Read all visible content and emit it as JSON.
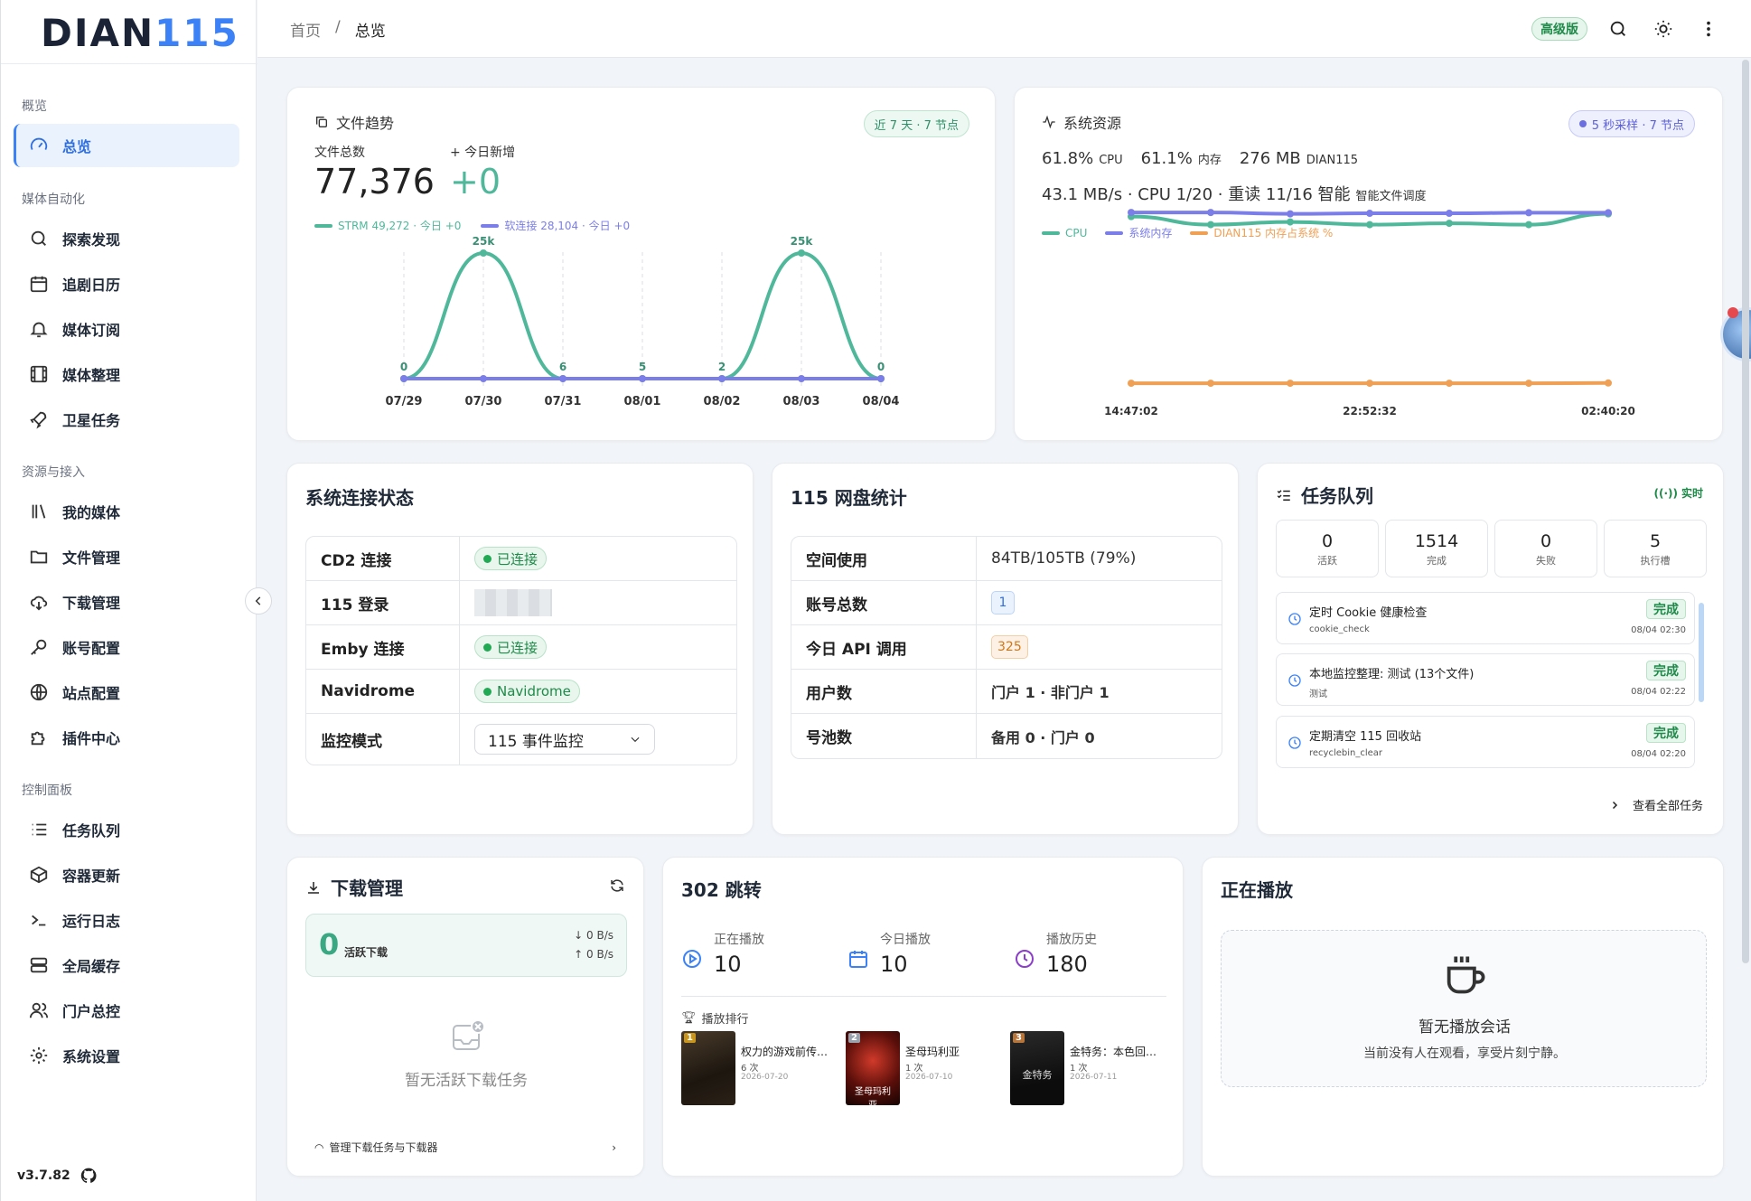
{
  "brand": {
    "logo_dark": "DIAN",
    "logo_blue": "115",
    "version": "v3.7.82"
  },
  "sidebar": {
    "sections": [
      "概览",
      "媒体自动化",
      "资源与接入",
      "控制面板"
    ],
    "items": [
      {
        "label": "总览",
        "icon": "gauge-icon"
      },
      {
        "label": "探索发现",
        "icon": "search-icon"
      },
      {
        "label": "追剧日历",
        "icon": "calendar-icon"
      },
      {
        "label": "媒体订阅",
        "icon": "bell-icon"
      },
      {
        "label": "媒体整理",
        "icon": "film-icon"
      },
      {
        "label": "卫星任务",
        "icon": "rocket-icon"
      },
      {
        "label": "我的媒体",
        "icon": "library-icon"
      },
      {
        "label": "文件管理",
        "icon": "folder-icon"
      },
      {
        "label": "下载管理",
        "icon": "cloud-download-icon"
      },
      {
        "label": "账号配置",
        "icon": "key-icon"
      },
      {
        "label": "站点配置",
        "icon": "globe-icon"
      },
      {
        "label": "插件中心",
        "icon": "puzzle-icon"
      },
      {
        "label": "任务队列",
        "icon": "list-icon"
      },
      {
        "label": "容器更新",
        "icon": "box-icon"
      },
      {
        "label": "运行日志",
        "icon": "terminal-icon"
      },
      {
        "label": "全局缓存",
        "icon": "server-icon"
      },
      {
        "label": "门户总控",
        "icon": "users-icon"
      },
      {
        "label": "系统设置",
        "icon": "gear-icon"
      }
    ]
  },
  "topbar": {
    "crumb_home": "首页",
    "crumb_sep": "/",
    "crumb_current": "总览",
    "edition": "高级版"
  },
  "file_trend": {
    "title": "文件趋势",
    "range_badge": "近 7 天 · 7 节点",
    "total_label": "文件总数",
    "total_value": "77,376",
    "today_label": "+ 今日新增",
    "today_value": "+0",
    "legend_strm": "STRM 49,272 · 今日 +0",
    "legend_soft": "软连接 28,104 · 今日 +0"
  },
  "sys_res": {
    "title": "系统资源",
    "badge": "5 秒采样 · 7 节点",
    "cpu_val": "61.8%",
    "cpu_lbl": "CPU",
    "mem_val": "61.1%",
    "mem_lbl": "内存",
    "proc_val": "276 MB",
    "proc_lbl": "DIAN115",
    "line2": "43.1 MB/s · CPU 1/20 · 重读 11/16 智能",
    "line2_sub": "智能文件调度",
    "legend": [
      "CPU",
      "系统内存",
      "DIAN115 内存占系统 %"
    ]
  },
  "conn": {
    "title": "系统连接状态",
    "rows": [
      {
        "k": "CD2 连接",
        "v": "已连接"
      },
      {
        "k": "115 登录",
        "v": ""
      },
      {
        "k": "Emby 连接",
        "v": "已连接"
      },
      {
        "k": "Navidrome",
        "v": "Navidrome"
      },
      {
        "k": "监控模式",
        "v": "115 事件监控"
      }
    ]
  },
  "disk": {
    "title": "115 网盘统计",
    "rows": [
      {
        "k": "空间使用",
        "v": "84TB/105TB (79%)"
      },
      {
        "k": "账号总数",
        "v": "1"
      },
      {
        "k": "今日 API 调用",
        "v": "325"
      },
      {
        "k": "用户数",
        "v": "门户 1 · 非门户 1"
      },
      {
        "k": "号池数",
        "v": "备用 0 · 门户 0"
      }
    ]
  },
  "queue": {
    "title": "任务队列",
    "live": "实时",
    "stats": [
      {
        "n": "0",
        "l": "活跃"
      },
      {
        "n": "1514",
        "l": "完成"
      },
      {
        "n": "0",
        "l": "失败"
      },
      {
        "n": "5",
        "l": "执行槽"
      }
    ],
    "tasks": [
      {
        "title": "定时 Cookie 健康检查",
        "sub": "cookie_check",
        "status": "完成",
        "time": "08/04 02:30"
      },
      {
        "title": "本地监控整理: 测试 (13个文件)",
        "sub": "测试",
        "status": "完成",
        "time": "08/04 02:22"
      },
      {
        "title": "定期清空 115 回收站",
        "sub": "recyclebin_clear",
        "status": "完成",
        "time": "08/04 02:20"
      }
    ],
    "view_all": "查看全部任务"
  },
  "download": {
    "title": "下载管理",
    "count": "0",
    "count_lbl": "活跃下载",
    "down": "↓ 0 B/s",
    "up": "↑ 0 B/s",
    "empty": "暂无活跃下载任务",
    "manage": "管理下载任务与下载器"
  },
  "redirect": {
    "title": "302 跳转",
    "stats": [
      {
        "l": "正在播放",
        "n": "10"
      },
      {
        "l": "今日播放",
        "n": "10"
      },
      {
        "l": "播放历史",
        "n": "180"
      }
    ],
    "rank_title": "播放排行",
    "rank": [
      {
        "no": "1",
        "name": "权力的游戏前传…",
        "count": "6 次",
        "date": "2026-07-20"
      },
      {
        "no": "2",
        "name": "圣母玛利亚",
        "count": "1 次",
        "date": "2026-07-10",
        "poster_text": "圣母玛利亚"
      },
      {
        "no": "3",
        "name": "金特务：本色回…",
        "count": "1 次",
        "date": "2026-07-11",
        "poster_text": "金特务"
      }
    ]
  },
  "playing": {
    "title": "正在播放",
    "empty_title": "暂无播放会话",
    "empty_sub": "当前没有人在观看，享受片刻宁静。"
  },
  "colors": {
    "accent": "#3b82f6",
    "green": "#1f8a49",
    "teal": "#4fb89a",
    "purple": "#7b7ee8",
    "orange": "#f0a055"
  },
  "chart_data": [
    {
      "type": "line",
      "title": "文件趋势",
      "x": [
        "07/29",
        "07/30",
        "07/31",
        "08/01",
        "08/02",
        "08/03",
        "08/04"
      ],
      "series": [
        {
          "name": "STRM",
          "values": [
            0,
            25000,
            6,
            5,
            2,
            25000,
            0
          ]
        },
        {
          "name": "软连接",
          "values": [
            0,
            0,
            0,
            0,
            0,
            0,
            0
          ]
        }
      ],
      "point_labels": [
        "0",
        "25k",
        "6",
        "5",
        "2",
        "25k",
        "0"
      ],
      "ylim": [
        0,
        25000
      ]
    },
    {
      "type": "line",
      "title": "系统资源",
      "x": [
        "14:47:02",
        "",
        "",
        "22:52:32",
        "",
        "",
        "02:40:20"
      ],
      "series": [
        {
          "name": "CPU",
          "values": [
            62,
            59,
            60,
            59,
            59.5,
            59,
            63
          ]
        },
        {
          "name": "系统内存",
          "values": [
            63.5,
            63.5,
            63,
            63.2,
            63.2,
            63.4,
            63.4
          ]
        },
        {
          "name": "DIAN115 内存占系统 %",
          "values": [
            0.3,
            0.3,
            0.3,
            0.3,
            0.3,
            0.3,
            0.4
          ]
        }
      ]
    }
  ]
}
